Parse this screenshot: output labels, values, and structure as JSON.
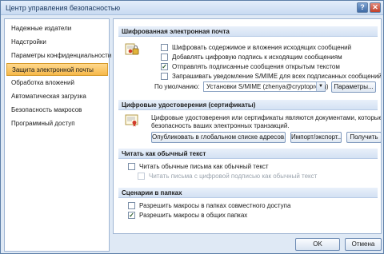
{
  "window": {
    "title": "Центр управления безопасностью",
    "help_label": "?",
    "close_label": "✕"
  },
  "sidebar": {
    "items": [
      {
        "label": "Надежные издатели",
        "active": false
      },
      {
        "label": "Надстройки",
        "active": false
      },
      {
        "label": "Параметры конфиденциальности",
        "active": false
      },
      {
        "label": "Защита электронной почты",
        "active": true
      },
      {
        "label": "Обработка вложений",
        "active": false
      },
      {
        "label": "Автоматическая загрузка",
        "active": false
      },
      {
        "label": "Безопасность макросов",
        "active": false
      },
      {
        "label": "Программный доступ",
        "active": false
      }
    ]
  },
  "encrypted": {
    "header": "Шифрованная электронная почта",
    "options": [
      {
        "label": "Шифровать содержимое и вложения исходящих сообщений",
        "checked": false
      },
      {
        "label": "Добавлять цифровую подпись к исходящим сообщениям",
        "checked": false
      },
      {
        "label": "Отправлять подписанные сообщения открытым текстом",
        "checked": true
      },
      {
        "label": "Запрашивать уведомление S/MIME для всех подписанных сообщений S/MIME",
        "checked": false
      }
    ],
    "default_label": "По умолчанию:",
    "default_value": "Установки S/MIME (zhenya@cryptopro.ru)",
    "settings_button": "Параметры..."
  },
  "certs": {
    "header": "Цифровые удостоверения (сертификаты)",
    "text_line1": "Цифровые удостоверения или сертификаты являются документами, которые обеспечи",
    "text_line2": "безопасность ваших электронных транзакций.",
    "publish_button": "Опубликовать в глобальном списке адресов...",
    "import_button": "Импорт/экспорт...",
    "get_button": "Получить"
  },
  "plaintext": {
    "header": "Читать как обычный текст",
    "option1": {
      "label": "Читать обычные письма как обычный текст",
      "checked": false
    },
    "option2": {
      "label": "Читать письма с цифровой подписью как обычный текст",
      "checked": false,
      "disabled": true
    }
  },
  "folders": {
    "header": "Сценарии в папках",
    "option1": {
      "label": "Разрешить макросы в папках совместного доступа",
      "checked": false
    },
    "option2": {
      "label": "Разрешить макросы в общих папках",
      "checked": true
    }
  },
  "footer": {
    "ok_label": "OK",
    "cancel_label": "Отмена"
  },
  "colors": {
    "active_item": "#f6b84a",
    "section_header": "#d3e1f3",
    "window_bg": "#dfe9f5"
  },
  "icons": {
    "encryption": "lock-certificate-icon",
    "certificate": "certificate-icon"
  }
}
